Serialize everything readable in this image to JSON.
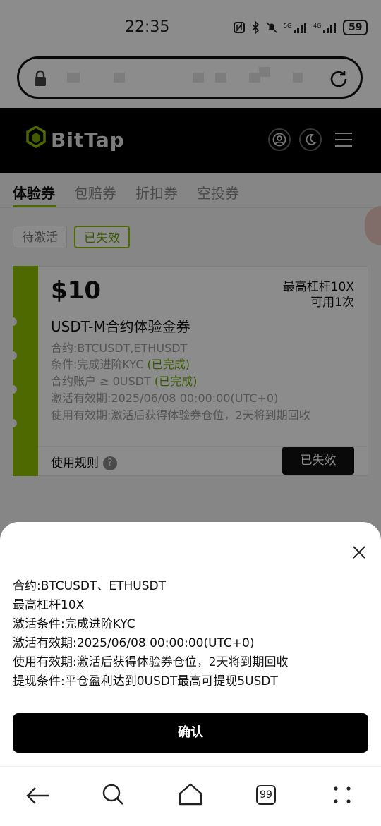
{
  "status": {
    "time": "22:35",
    "icons": [
      "nfc-icon",
      "bluetooth-icon",
      "bell-off-icon",
      "signal-5g-icon",
      "signal-4g-icon"
    ],
    "battery": "59"
  },
  "url_bar": {
    "left_icon": "lock-icon",
    "right_icon": "refresh-icon"
  },
  "header": {
    "brand": "BitTap",
    "icons": [
      "user-icon",
      "moon-icon",
      "menu-icon"
    ]
  },
  "tabs": [
    {
      "label": "体验券",
      "active": true
    },
    {
      "label": "包赔券",
      "active": false
    },
    {
      "label": "折扣券",
      "active": false
    },
    {
      "label": "空投券",
      "active": false
    }
  ],
  "filters": {
    "pending": "待激活",
    "expired": "已失效"
  },
  "coupon": {
    "amount": "$10",
    "max_leverage": "最高杠杆10X",
    "usable": "可用1次",
    "title": "USDT-M合约体验金券",
    "contract": "合约:BTCUSDT,ETHUSDT",
    "condition": "条件:完成进阶KYC",
    "condition_status": "(已完成)",
    "account": "合约账户 ≥ 0USDT",
    "account_status": "(已完成)",
    "activation_period": "激活有效期:2025/06/08 00:00:00(UTC+0)",
    "usage_period": "使用有效期:激活后获得体验券仓位，2天将到期回收",
    "rules_label": "使用规则",
    "rules_help": "?",
    "status_button": "已失效"
  },
  "sheet": {
    "lines": [
      "合约:BTCUSDT、ETHUSDT",
      "最高杠杆10X",
      "激活条件:完成进阶KYC",
      "激活有效期:2025/06/08 00:00:00(UTC+0)",
      "使用有效期:激活后获得体验券仓位，2天将到期回收",
      "提现条件:平仓盈利达到0USDT最高可提现5USDT"
    ],
    "confirm": "确认"
  },
  "browser_nav": {
    "tab_count": "99",
    "icons": [
      "back-arrow-icon",
      "search-icon",
      "home-icon",
      "tabs-icon",
      "more-icon"
    ]
  },
  "colors": {
    "accent": "#8cbf00",
    "header_bg": "#000000"
  }
}
